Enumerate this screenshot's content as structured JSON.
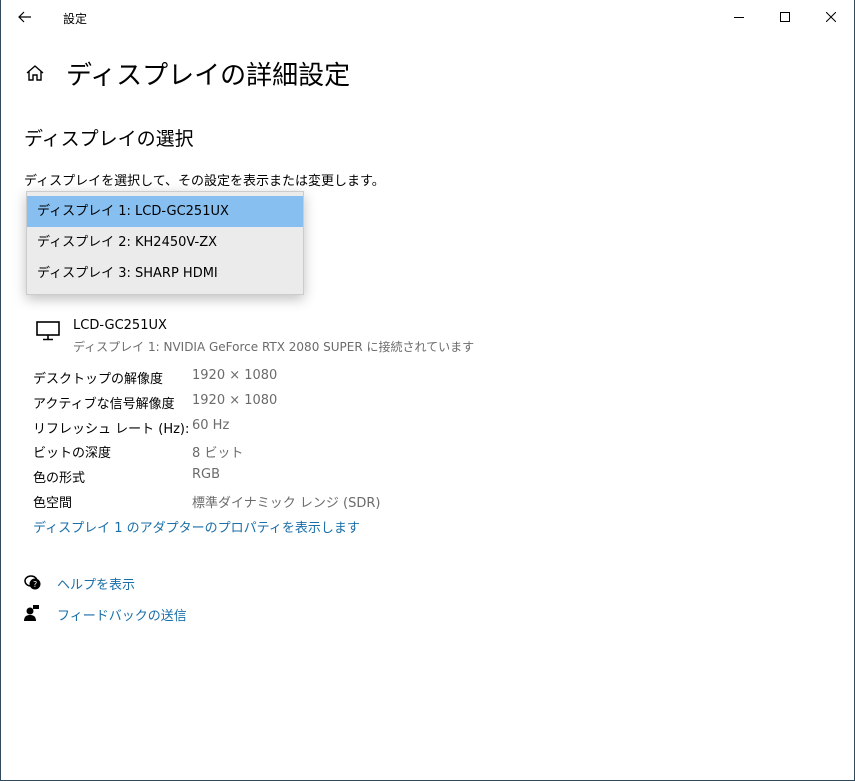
{
  "titlebar": {
    "title": "設定",
    "back_icon": "arrow-left",
    "minimize_icon": "minimize",
    "maximize_icon": "maximize",
    "close_icon": "close"
  },
  "page": {
    "title": "ディスプレイの詳細設定",
    "home_icon": "home"
  },
  "section": {
    "title": "ディスプレイの選択",
    "description": "ディスプレイを選択して、その設定を表示または変更します。"
  },
  "dropdown": {
    "options": [
      {
        "label": "ディスプレイ 1: LCD-GC251UX",
        "selected": true
      },
      {
        "label": "ディスプレイ 2: KH2450V-ZX",
        "selected": false
      },
      {
        "label": "ディスプレイ 3: SHARP HDMI",
        "selected": false
      }
    ]
  },
  "display_info": {
    "name": "LCD-GC251UX",
    "subtitle": "ディスプレイ 1: NVIDIA GeForce RTX 2080 SUPER に接続されています",
    "rows": [
      {
        "label": "デスクトップの解像度",
        "value": "1920 × 1080"
      },
      {
        "label": "アクティブな信号解像度",
        "value": "1920 × 1080"
      },
      {
        "label": "リフレッシュ レート (Hz):",
        "value": "60 Hz"
      },
      {
        "label": "ビットの深度",
        "value": "8 ビット"
      },
      {
        "label": "色の形式",
        "value": "RGB"
      },
      {
        "label": "色空間",
        "value": "標準ダイナミック レンジ (SDR)"
      }
    ],
    "adapter_link": "ディスプレイ 1 のアダプターのプロパティを表示します"
  },
  "footer": {
    "help": "ヘルプを表示",
    "feedback": "フィードバックの送信"
  },
  "colors": {
    "accent": "#1a6fa8",
    "selected": "#86bff0",
    "border": "#2e4a5c"
  }
}
